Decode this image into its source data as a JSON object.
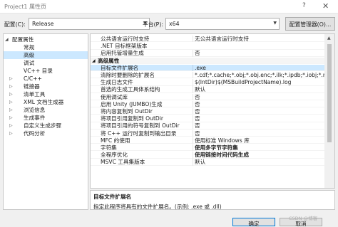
{
  "window": {
    "title": "Project1 属性页",
    "help": "?",
    "close": "✕"
  },
  "config_bar": {
    "config_label": "配置(C):",
    "config_value": "Release",
    "platform_label": "平台(P):",
    "platform_value": "x64",
    "config_manager": "配置管理器(O)..."
  },
  "tree": {
    "items": [
      {
        "label": "配置属性",
        "expander": "◢",
        "selected": false
      },
      {
        "label": "常规",
        "selected": false
      },
      {
        "label": "高级",
        "selected": true
      },
      {
        "label": "调试",
        "selected": false
      },
      {
        "label": "VC++ 目录",
        "selected": false
      },
      {
        "label": "C/C++",
        "expander": "▷",
        "selected": false
      },
      {
        "label": "链接器",
        "expander": "▷",
        "selected": false
      },
      {
        "label": "清单工具",
        "expander": "▷",
        "selected": false
      },
      {
        "label": "XML 文档生成器",
        "expander": "▷",
        "selected": false
      },
      {
        "label": "浏览信息",
        "expander": "▷",
        "selected": false
      },
      {
        "label": "生成事件",
        "expander": "▷",
        "selected": false
      },
      {
        "label": "自定义生成步骤",
        "expander": "▷",
        "selected": false
      },
      {
        "label": "代码分析",
        "expander": "▷",
        "selected": false
      }
    ]
  },
  "properties": {
    "rows": [
      {
        "name": "公共语言运行时支持",
        "value": "无公共语言运行时支持"
      },
      {
        "name": ".NET 目标框架版本",
        "value": ""
      },
      {
        "name": "启用托管增量生成",
        "value": "否"
      },
      {
        "name": "高级属性",
        "category": true,
        "expander": "◢"
      },
      {
        "name": "目标文件扩展名",
        "value": ".exe",
        "highlight": true
      },
      {
        "name": "清除时要删除的扩展名",
        "value": "*.cdf;*.cache;*.obj;*.obj.enc;*.ilk;*.ipdb;*.iobj;*.resource"
      },
      {
        "name": "生成日志文件",
        "value": "$(IntDir)$(MSBuildProjectName).log"
      },
      {
        "name": "首选的生成工具体系结构",
        "value": "默认"
      },
      {
        "name": "使用调试库",
        "value": "否"
      },
      {
        "name": "启用 Unity (JUMBO)生成",
        "value": "否"
      },
      {
        "name": "将内容复制到 OutDir",
        "value": "否"
      },
      {
        "name": "将项目引用复制到 OutDir",
        "value": "否"
      },
      {
        "name": "将项目引用的符号复制到 OutDir",
        "value": "否"
      },
      {
        "name": "将 C++ 运行时复制到输出目录",
        "value": "否"
      },
      {
        "name": "MFC 的使用",
        "value": "使用标准 Windows 库"
      },
      {
        "name": "字符集",
        "value": "使用多字节字符集",
        "bold": true
      },
      {
        "name": "全程序优化",
        "value": "使用链接时间代码生成",
        "bold": true
      },
      {
        "name": "MSVC 工具集版本",
        "value": "默认"
      }
    ]
  },
  "description": {
    "title": "目标文件扩展名",
    "text": "指定此程序将具有的文件扩展名。(示例: .exe 或 .dll)"
  },
  "buttons": {
    "ok": "确定",
    "cancel": "取消"
  },
  "watermark": "CSDN @博客"
}
